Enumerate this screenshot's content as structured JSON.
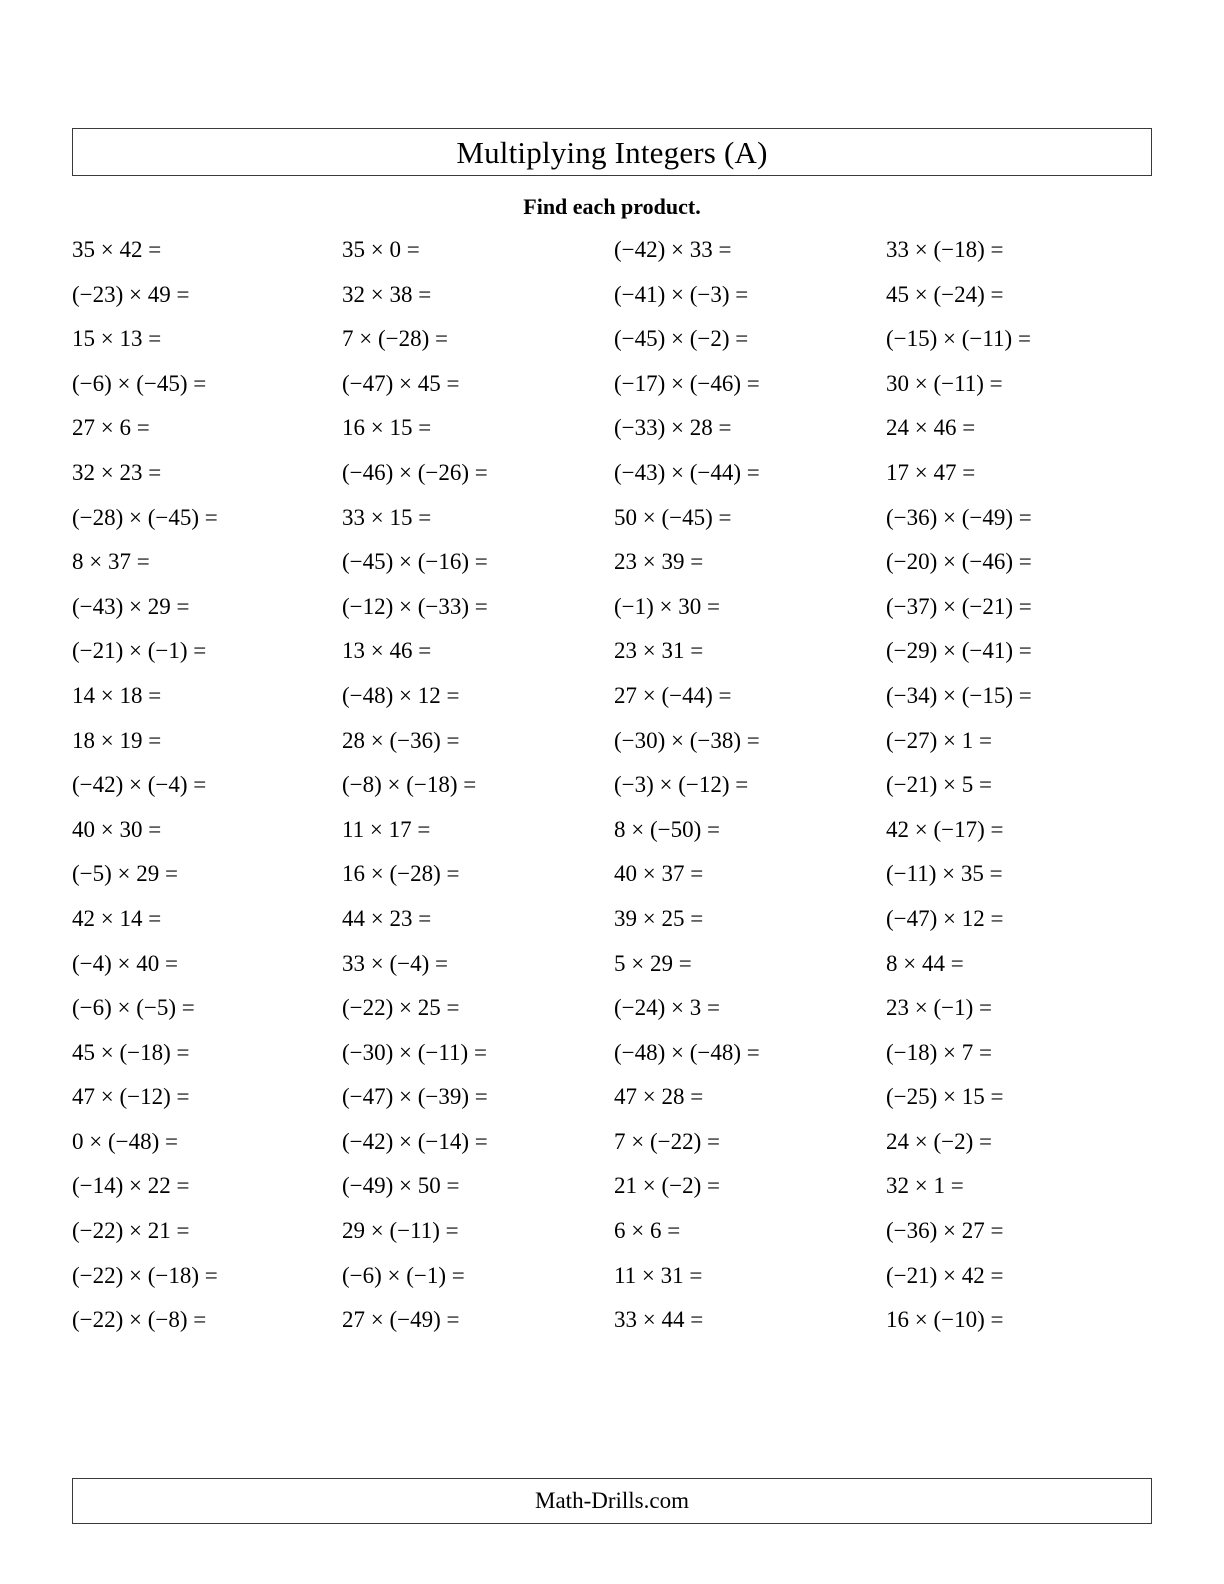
{
  "header": {
    "title": "Multiplying Integers (A)",
    "instruction": "Find each product."
  },
  "footer": {
    "attribution": "Math-Drills.com"
  },
  "worksheet": {
    "columns": 4,
    "rows": 25,
    "problems": [
      [
        "35 × 42 =",
        "35 × 0 =",
        "(−42) × 33 =",
        "33 × (−18) ="
      ],
      [
        "(−23) × 49 =",
        "32 × 38 =",
        "(−41) × (−3) =",
        "45 × (−24) ="
      ],
      [
        "15 × 13 =",
        "7 × (−28) =",
        "(−45) × (−2) =",
        "(−15) × (−11) ="
      ],
      [
        "(−6) × (−45) =",
        "(−47) × 45 =",
        "(−17) × (−46) =",
        "30 × (−11) ="
      ],
      [
        "27 × 6 =",
        "16 × 15 =",
        "(−33) × 28 =",
        "24 × 46 ="
      ],
      [
        "32 × 23 =",
        "(−46) × (−26) =",
        "(−43) × (−44) =",
        "17 × 47 ="
      ],
      [
        "(−28) × (−45) =",
        "33 × 15 =",
        "50 × (−45) =",
        "(−36) × (−49) ="
      ],
      [
        "8 × 37 =",
        "(−45) × (−16) =",
        "23 × 39 =",
        "(−20) × (−46) ="
      ],
      [
        "(−43) × 29 =",
        "(−12) × (−33) =",
        "(−1) × 30 =",
        "(−37) × (−21) ="
      ],
      [
        "(−21) × (−1) =",
        "13 × 46 =",
        "23 × 31 =",
        "(−29) × (−41) ="
      ],
      [
        "14 × 18 =",
        "(−48) × 12 =",
        "27 × (−44) =",
        "(−34) × (−15) ="
      ],
      [
        "18 × 19 =",
        "28 × (−36) =",
        "(−30) × (−38) =",
        "(−27) × 1 ="
      ],
      [
        "(−42) × (−4) =",
        "(−8) × (−18) =",
        "(−3) × (−12) =",
        "(−21) × 5 ="
      ],
      [
        "40 × 30 =",
        "11 × 17 =",
        "8 × (−50) =",
        "42 × (−17) ="
      ],
      [
        "(−5) × 29 =",
        "16 × (−28) =",
        "40 × 37 =",
        "(−11) × 35 ="
      ],
      [
        "42 × 14 =",
        "44 × 23 =",
        "39 × 25 =",
        "(−47) × 12 ="
      ],
      [
        "(−4) × 40 =",
        "33 × (−4) =",
        "5 × 29 =",
        "8 × 44 ="
      ],
      [
        "(−6) × (−5) =",
        "(−22) × 25 =",
        "(−24) × 3 =",
        "23 × (−1) ="
      ],
      [
        "45 × (−18) =",
        "(−30) × (−11) =",
        "(−48) × (−48) =",
        "(−18) × 7 ="
      ],
      [
        "47 × (−12) =",
        "(−47) × (−39) =",
        "47 × 28 =",
        "(−25) × 15 ="
      ],
      [
        "0 × (−48) =",
        "(−42) × (−14) =",
        "7 × (−22) =",
        "24 × (−2) ="
      ],
      [
        "(−14) × 22 =",
        "(−49) × 50 =",
        "21 × (−2) =",
        "32 × 1 ="
      ],
      [
        "(−22) × 21 =",
        "29 × (−11) =",
        "6 × 6 =",
        "(−36) × 27 ="
      ],
      [
        "(−22) × (−18) =",
        "(−6) × (−1) =",
        "11 × 31 =",
        "(−21) × 42 ="
      ],
      [
        "(−22) × (−8) =",
        "27 × (−49) =",
        "33 × 44 =",
        "16 × (−10) ="
      ]
    ]
  }
}
